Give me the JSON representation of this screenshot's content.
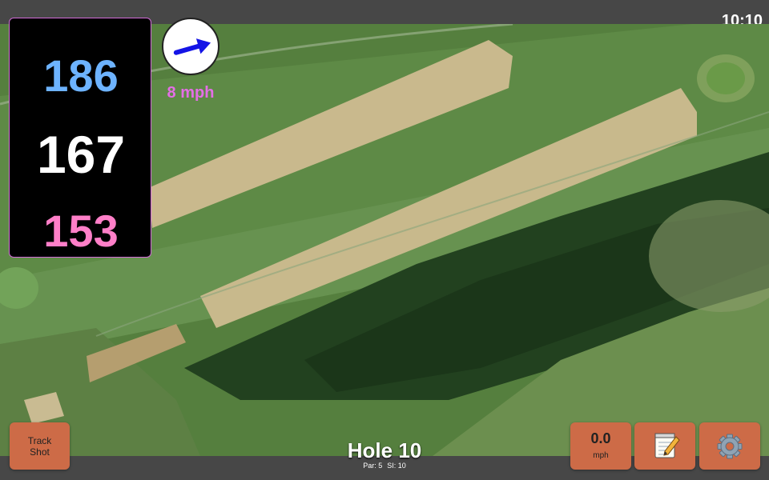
{
  "status_bar": {
    "clock": "10:10"
  },
  "distances": {
    "back": {
      "value": "186",
      "color": "#6db3ff"
    },
    "middle": {
      "value": "167",
      "color": "#ffffff"
    },
    "front": {
      "value": "153",
      "color": "#ff7fc8"
    }
  },
  "wind": {
    "speed_label": "8 mph",
    "text_color": "#e46ee6",
    "arrow_icon": "wind-direction-arrow",
    "arrow_color": "#1414e6",
    "heading_deg": -16
  },
  "buttons": {
    "track_shot": [
      "Track",
      "Shot"
    ],
    "wind_value": "0.0",
    "wind_unit": "mph",
    "notes_icon": "notepad-icon",
    "settings_icon": "gear-icon",
    "button_color": "#cd6b47"
  },
  "hole": {
    "title": "Hole 10",
    "par_label": "Par: 5",
    "si_label": "SI: 10"
  }
}
